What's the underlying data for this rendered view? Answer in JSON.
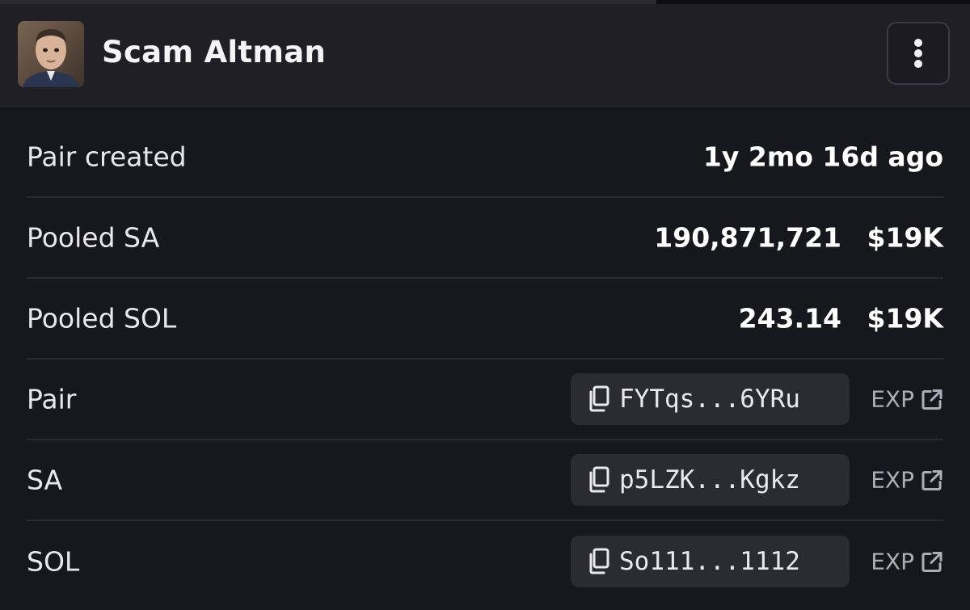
{
  "header": {
    "token_name": "Scam Altman",
    "avatar_icon": "profile-photo",
    "menu_icon": "kebab-menu-icon"
  },
  "rows": [
    {
      "label": "Pair created",
      "value": "1y 2mo 16d ago"
    },
    {
      "label": "Pooled SA",
      "amount": "190,871,721",
      "usd": "$19K"
    },
    {
      "label": "Pooled SOL",
      "amount": "243.14",
      "usd": "$19K"
    },
    {
      "label": "Pair",
      "address": "FYTqs...6YRu",
      "link": "EXP"
    },
    {
      "label": "SA",
      "address": "p5LZK...Kgkz",
      "link": "EXP"
    },
    {
      "label": "SOL",
      "address": "So111...1112",
      "link": "EXP"
    }
  ],
  "icons": {
    "copy": "copy-icon",
    "external": "external-link-icon"
  },
  "colors": {
    "background": "#17171e",
    "header": "#1f1f25",
    "chip": "#2b2b32",
    "muted": "#aeaeb8"
  }
}
